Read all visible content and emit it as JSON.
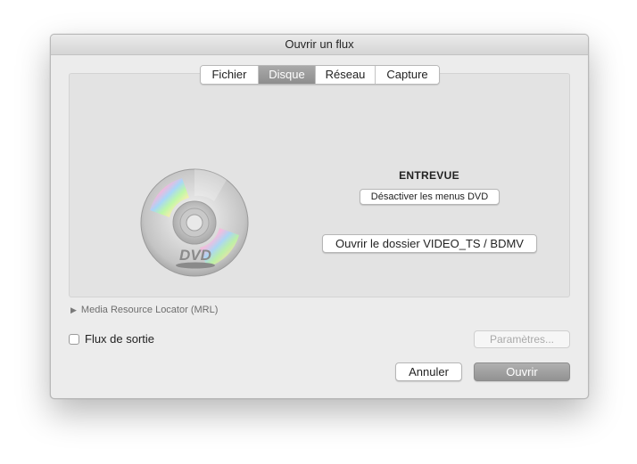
{
  "window": {
    "title": "Ouvrir un flux"
  },
  "tabs": [
    {
      "label": "Fichier",
      "active": false
    },
    {
      "label": "Disque",
      "active": true
    },
    {
      "label": "Réseau",
      "active": false
    },
    {
      "label": "Capture",
      "active": false
    }
  ],
  "disc": {
    "icon": "dvd-disc-icon",
    "logo_text": "DVD",
    "title": "ENTREVUE",
    "disable_menus_label": "Désactiver les menus DVD",
    "open_folder_label": "Ouvrir le dossier VIDEO_TS / BDMV"
  },
  "mrl": {
    "label": "Media Resource Locator (MRL)",
    "expanded": false
  },
  "output": {
    "checkbox_label": "Flux de sortie",
    "checked": false,
    "params_label": "Paramètres..."
  },
  "actions": {
    "cancel_label": "Annuler",
    "open_label": "Ouvrir"
  },
  "colors": {
    "window_bg": "#ececec",
    "panel_bg": "#e3e3e3",
    "active_tab": "#999999",
    "primary_button": "#a0a0a0"
  }
}
